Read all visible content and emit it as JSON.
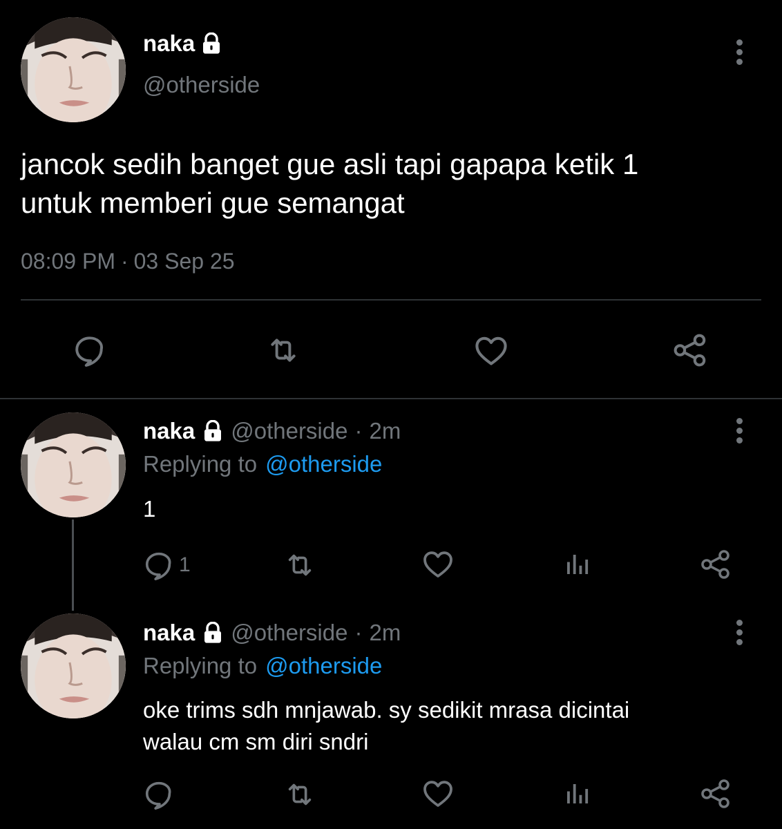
{
  "main_tweet": {
    "display_name": "naka",
    "handle": "@otherside",
    "text_line1": "jancok sedih banget gue asli tapi gapapa ketik 1",
    "text_line2": "untuk memberi gue semangat",
    "time": "08:09 PM",
    "separator": "·",
    "date": "03 Sep 25"
  },
  "replies": [
    {
      "display_name": "naka",
      "handle": "@otherside",
      "separator": "·",
      "age": "2m",
      "replying_prefix": "Replying to",
      "replying_handle": "@otherside",
      "text_line1": "1",
      "text_line2": "",
      "reply_count": "1"
    },
    {
      "display_name": "naka",
      "handle": "@otherside",
      "separator": "·",
      "age": "2m",
      "replying_prefix": "Replying to",
      "replying_handle": "@otherside",
      "text_line1": "oke trims sdh mnjawab. sy sedikit mrasa dicintai",
      "text_line2": "walau cm sm diri sndri",
      "reply_count": ""
    }
  ],
  "icons": {
    "reply": "reply-icon",
    "retweet": "retweet-icon",
    "like": "heart-icon",
    "analytics": "analytics-icon",
    "share": "share-icon",
    "more": "more-vertical-icon",
    "lock": "lock-icon"
  },
  "colors": {
    "background": "#000000",
    "text": "#e7e9ea",
    "muted": "#71767b",
    "link": "#1d9bf0",
    "divider": "#2f3336"
  }
}
